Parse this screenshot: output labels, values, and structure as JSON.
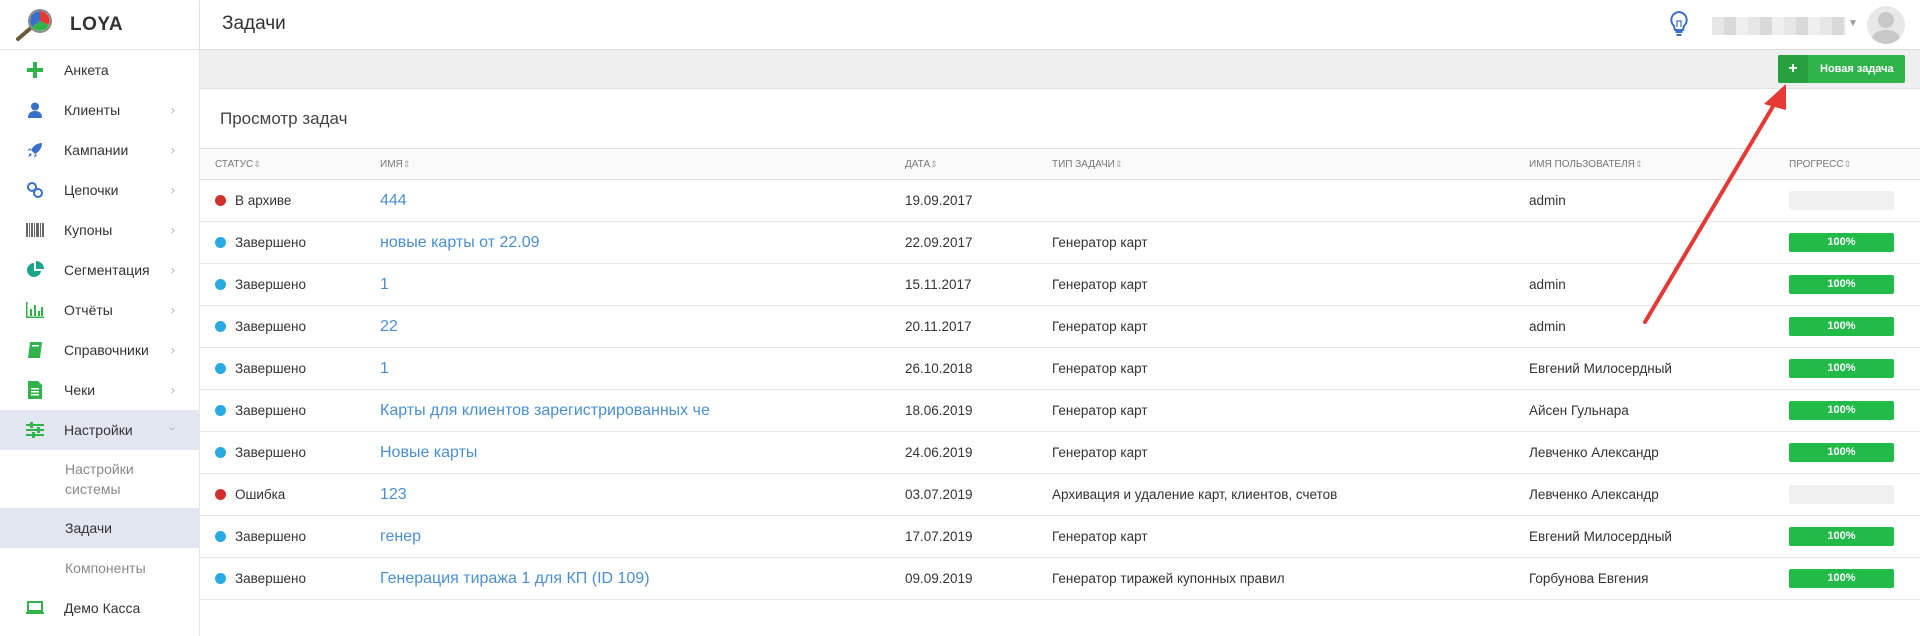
{
  "brand": {
    "name": "LOYA"
  },
  "header": {
    "title": "Задачи"
  },
  "sidebar": {
    "items": [
      {
        "label": "Анкета",
        "icon": "plus-icon",
        "color": "#2fb34a"
      },
      {
        "label": "Клиенты",
        "icon": "user-icon",
        "color": "#3a6fc8"
      },
      {
        "label": "Кампании",
        "icon": "rocket-icon",
        "color": "#3a6fc8"
      },
      {
        "label": "Цепочки",
        "icon": "chain-icon",
        "color": "#3a6fc8"
      },
      {
        "label": "Купоны",
        "icon": "barcode-icon",
        "color": "#555"
      },
      {
        "label": "Сегментация",
        "icon": "pie-chart-icon",
        "color": "#1aa58a"
      },
      {
        "label": "Отчёты",
        "icon": "bar-chart-icon",
        "color": "#2fb34a"
      },
      {
        "label": "Справочники",
        "icon": "book-icon",
        "color": "#2fb34a"
      },
      {
        "label": "Чеки",
        "icon": "receipt-icon",
        "color": "#2fb34a"
      },
      {
        "label": "Настройки",
        "icon": "sliders-icon",
        "color": "#2fb34a"
      }
    ],
    "sub_items": [
      "Настройки системы",
      "Задачи",
      "Компоненты"
    ],
    "bottom_item": {
      "label": "Демо Касса",
      "icon": "laptop-icon",
      "color": "#2fb34a"
    }
  },
  "toolbar": {
    "new_task_label": "Новая задача"
  },
  "panel": {
    "title": "Просмотр задач"
  },
  "table": {
    "columns": [
      "СТАТУС",
      "ИМЯ",
      "ДАТА",
      "ТИП ЗАДАЧИ",
      "ИМЯ ПОЛЬЗОВАТЕЛЯ",
      "ПРОГРЕСС"
    ],
    "rows": [
      {
        "status": "В архиве",
        "status_color": "#d0312d",
        "name": "444",
        "date": "19.09.2017",
        "type": "",
        "user": "admin",
        "progress": 0,
        "progress_label": ""
      },
      {
        "status": "Завершено",
        "status_color": "#29abe2",
        "name": "новые карты от 22.09",
        "date": "22.09.2017",
        "type": "Генератор карт",
        "user": "",
        "progress": 100,
        "progress_label": "100%"
      },
      {
        "status": "Завершено",
        "status_color": "#29abe2",
        "name": "1",
        "date": "15.11.2017",
        "type": "Генератор карт",
        "user": "admin",
        "progress": 100,
        "progress_label": "100%"
      },
      {
        "status": "Завершено",
        "status_color": "#29abe2",
        "name": "22",
        "date": "20.11.2017",
        "type": "Генератор карт",
        "user": "admin",
        "progress": 100,
        "progress_label": "100%"
      },
      {
        "status": "Завершено",
        "status_color": "#29abe2",
        "name": "1",
        "date": "26.10.2018",
        "type": "Генератор карт",
        "user": "Евгений Милосердный",
        "progress": 100,
        "progress_label": "100%"
      },
      {
        "status": "Завершено",
        "status_color": "#29abe2",
        "name": "Карты для клиентов зарегистрированных че",
        "date": "18.06.2019",
        "type": "Генератор карт",
        "user": "Айсен Гульнара",
        "progress": 100,
        "progress_label": "100%"
      },
      {
        "status": "Завершено",
        "status_color": "#29abe2",
        "name": "Новые карты",
        "date": "24.06.2019",
        "type": "Генератор карт",
        "user": "Левченко Александр",
        "progress": 100,
        "progress_label": "100%"
      },
      {
        "status": "Ошибка",
        "status_color": "#d0312d",
        "name": "123",
        "date": "03.07.2019",
        "type": "Архивация и удаление карт, клиентов, счетов",
        "user": "Левченко Александр",
        "progress": 0,
        "progress_label": ""
      },
      {
        "status": "Завершено",
        "status_color": "#29abe2",
        "name": "генер",
        "date": "17.07.2019",
        "type": "Генератор карт",
        "user": "Евгений Милосердный",
        "progress": 100,
        "progress_label": "100%"
      },
      {
        "status": "Завершено",
        "status_color": "#29abe2",
        "name": "Генерация тиража 1 для КП (ID 109)",
        "date": "09.09.2019",
        "type": "Генератор тиражей купонных правил",
        "user": "Горбунова Евгения",
        "progress": 100,
        "progress_label": "100%"
      }
    ]
  },
  "colors": {
    "accent_green": "#2fb34a",
    "progress_green": "#22bb4a",
    "link_blue": "#4a8fd1",
    "annotation_arrow": "#e53935"
  }
}
